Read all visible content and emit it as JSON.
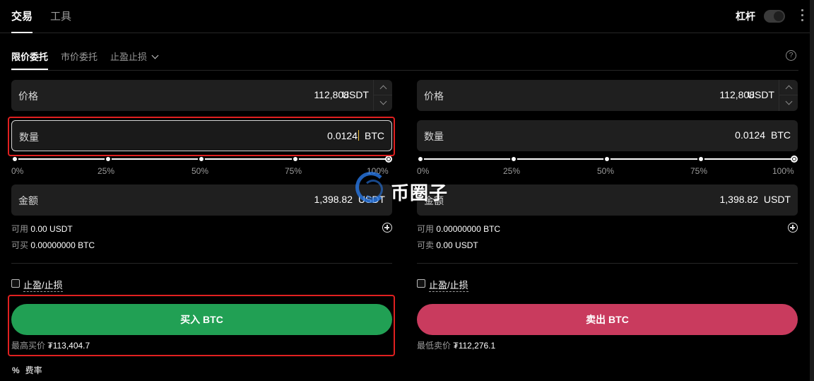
{
  "header": {
    "tabs": [
      {
        "label": "交易"
      },
      {
        "label": "工具"
      }
    ],
    "leverage_label": "杠杆"
  },
  "order_types": {
    "limit": "限价委托",
    "market": "市价委托",
    "tpsl": "止盈止损",
    "help": "?"
  },
  "buy": {
    "price_label": "价格",
    "price_value": "112,808",
    "price_unit": "USDT",
    "qty_label": "数量",
    "qty_value": "0.0124",
    "qty_unit": "BTC",
    "amount_label": "金额",
    "amount_value": "1,398.82",
    "amount_unit": "USDT",
    "avail_key": "可用",
    "avail_value": "0.00 USDT",
    "can_key": "可买",
    "can_value": "0.00000000 BTC",
    "tpsl_label": "止盈/止损",
    "action_label": "买入 BTC",
    "best_key": "最高买价",
    "best_value": "₮113,404.7"
  },
  "sell": {
    "price_label": "价格",
    "price_value": "112,808",
    "price_unit": "USDT",
    "qty_label": "数量",
    "qty_value": "0.0124",
    "qty_unit": "BTC",
    "amount_label": "金额",
    "amount_value": "1,398.82",
    "amount_unit": "USDT",
    "avail_key": "可用",
    "avail_value": "0.00000000 BTC",
    "can_key": "可卖",
    "can_value": "0.00 USDT",
    "tpsl_label": "止盈/止损",
    "action_label": "卖出 BTC",
    "best_key": "最低卖价",
    "best_value": "₮112,276.1"
  },
  "slider_marks": [
    "0%",
    "25%",
    "50%",
    "75%",
    "100%"
  ],
  "slider_value_percent": 100,
  "fee": {
    "icon": "%",
    "label": "费率"
  },
  "watermark": {
    "text": "币圈子"
  },
  "colors": {
    "buy": "#21a054",
    "sell": "#c93b5e",
    "highlight": "#e02020"
  },
  "icons": [
    "chevron-down-icon",
    "help-icon",
    "plus-circle-icon",
    "more-vertical-icon",
    "percent-icon"
  ]
}
